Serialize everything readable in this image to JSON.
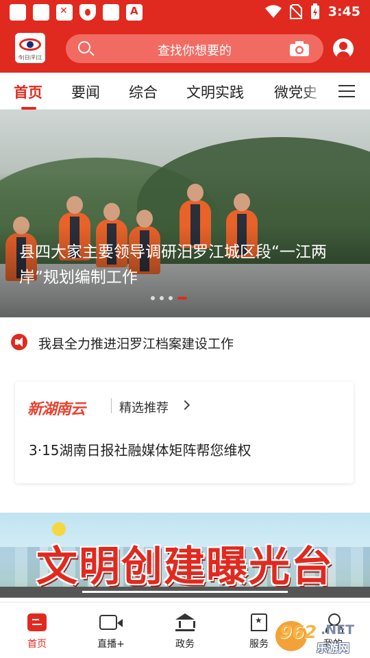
{
  "status_bar": {
    "time": "3:45",
    "icons": [
      "app-icon",
      "app-icon",
      "close-badge-icon",
      "shield-icon",
      "app-icon",
      "pdf-icon",
      "wifi-icon",
      "no-sim-icon",
      "battery-charging-icon"
    ]
  },
  "header": {
    "logo_text": "今|日|平|江",
    "search_placeholder": "查找你想要的",
    "accent_color": "#e02a1f"
  },
  "tabs": [
    {
      "label": "首页",
      "active": true
    },
    {
      "label": "要闻",
      "active": false
    },
    {
      "label": "综合",
      "active": false
    },
    {
      "label": "文明实践",
      "active": false
    },
    {
      "label": "微党史",
      "active": false
    }
  ],
  "banner": {
    "title": "县四大家主要领导调研汨罗江城区段“一江两岸”规划编制工作",
    "slide_count": 4,
    "active_slide": 4
  },
  "notice": {
    "text": "我县全力推进汨罗江档案建设工作"
  },
  "card": {
    "brand": "新湖南云",
    "subtitle": "精选推荐",
    "headline": "3·15湖南日报社融媒体矩阵帮您维权"
  },
  "ad_banner": {
    "text": "文明创建曝光台"
  },
  "bottom_nav": [
    {
      "label": "首页",
      "icon": "home-icon",
      "active": true
    },
    {
      "label": "直播+",
      "icon": "video-icon",
      "active": false
    },
    {
      "label": "政务",
      "icon": "government-icon",
      "active": false
    },
    {
      "label": "服务",
      "icon": "service-icon",
      "active": false
    },
    {
      "label": "我的",
      "icon": "user-icon",
      "active": false
    }
  ],
  "watermark": {
    "number": "962",
    "suffix": ".NET",
    "site": "乐游网"
  }
}
